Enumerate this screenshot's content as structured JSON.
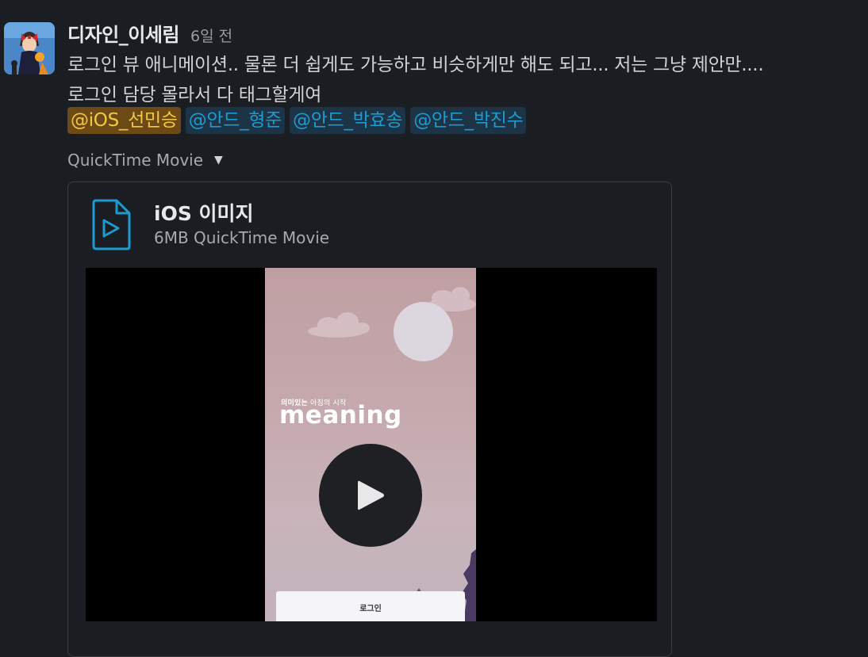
{
  "message": {
    "author": "디자인_이세림",
    "timestamp": "6일 전",
    "lines": [
      "로그인 뷰 애니메이션.. 물론 더 쉽게도 가능하고 비슷하게만 해도 되고... 저는 그냥 제안만....",
      "로그인 담당 몰라서 다 태그할게여"
    ],
    "mentions": [
      {
        "label": "@iOS_선민승",
        "is_self": true
      },
      {
        "label": "@안드_형준",
        "is_self": false
      },
      {
        "label": "@안드_박효송",
        "is_self": false
      },
      {
        "label": "@안드_박진수",
        "is_self": false
      }
    ]
  },
  "attachment": {
    "type_label": "QuickTime Movie",
    "title": "iOS 이미지",
    "meta": "6MB QuickTime Movie",
    "preview": {
      "tagline_bold": "의미있는",
      "tagline_rest": " 아침의 시작",
      "brand": "meaning",
      "login_label": "로그인"
    }
  },
  "colors": {
    "background": "#1a1d21",
    "mention_self_bg": "#6b4a16",
    "mention_self_text": "#f2c744",
    "mention_other_bg": "#1c3445",
    "mention_other_text": "#1d9bd1",
    "file_icon": "#1d9bd1"
  },
  "icons": {
    "file": "video-file-icon",
    "play": "play-icon",
    "caret": "caret-down-icon"
  }
}
